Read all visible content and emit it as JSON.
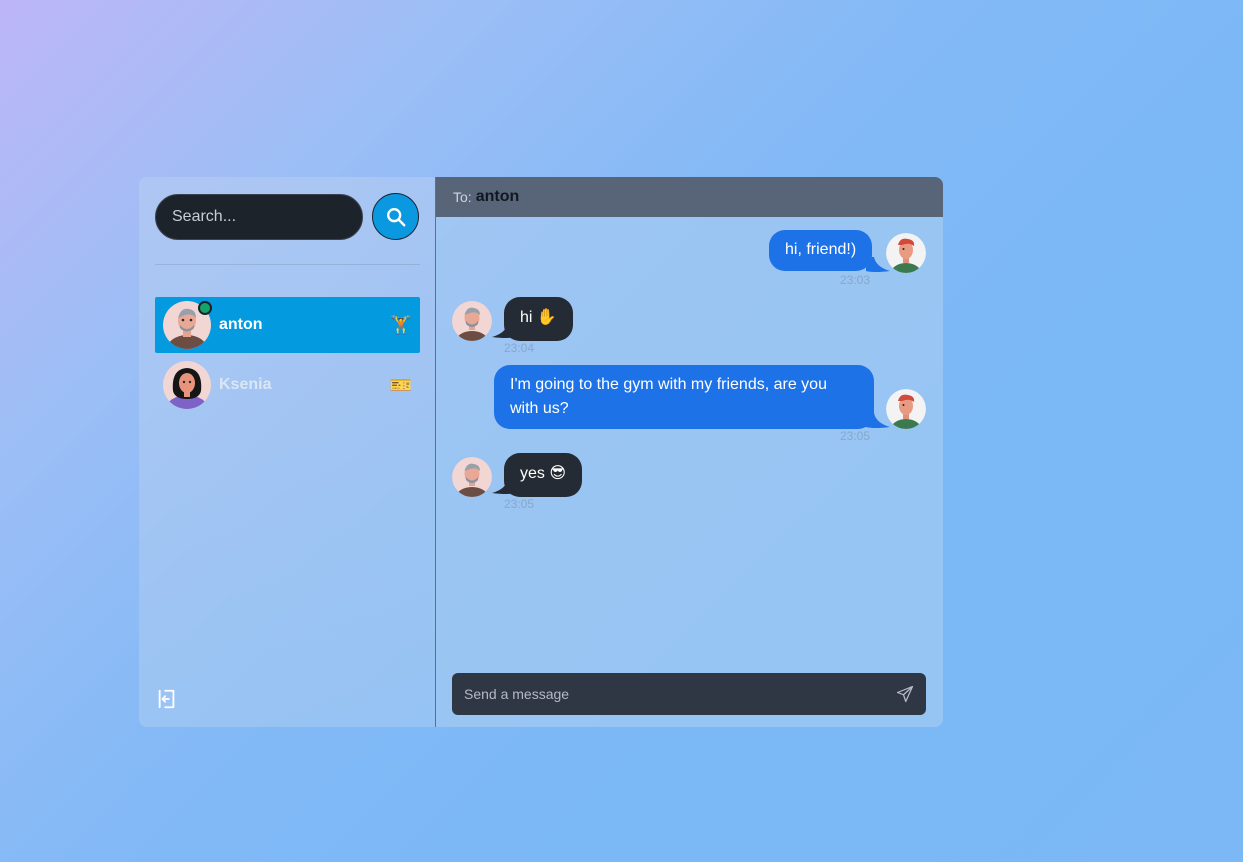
{
  "search": {
    "placeholder": "Search..."
  },
  "contacts": [
    {
      "name": "anton",
      "status_emoji": "🏋️",
      "online": true,
      "active": true
    },
    {
      "name": "Ksenia",
      "status_emoji": "🎫",
      "online": false,
      "active": false
    }
  ],
  "chat": {
    "to_label": "To:",
    "to_name": "anton",
    "messages": [
      {
        "direction": "outgoing",
        "text": "hi, friend!)",
        "time": "23:03"
      },
      {
        "direction": "incoming",
        "text": "hi ✋",
        "time": "23:04"
      },
      {
        "direction": "outgoing",
        "text": "I'm going to the gym with my friends, are you with us?",
        "time": "23:05"
      },
      {
        "direction": "incoming",
        "text": "yes 😎",
        "time": "23:05"
      }
    ],
    "composer_placeholder": "Send a message"
  },
  "icons": {
    "search": "search-icon",
    "logout": "logout-icon",
    "send": "send-icon"
  },
  "colors": {
    "accent": "#049ae0",
    "outgoing_bubble": "#1e72e8",
    "incoming_bubble": "#252b34",
    "online": "#14a36a"
  }
}
